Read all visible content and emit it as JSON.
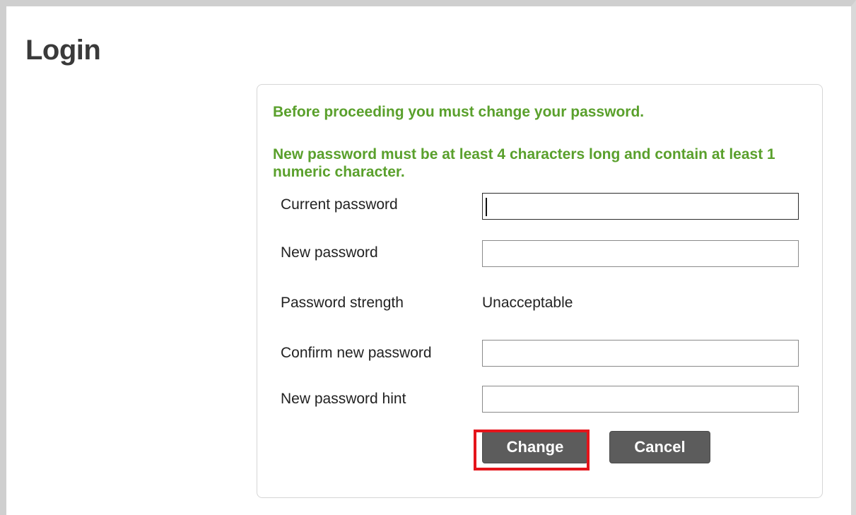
{
  "page": {
    "title": "Login"
  },
  "notices": {
    "line1": "Before proceeding you must change your password.",
    "line2": "New password must be at least 4 characters long and contain at least 1 numeric character."
  },
  "form": {
    "current_password": {
      "label": "Current password",
      "value": ""
    },
    "new_password": {
      "label": "New password",
      "value": ""
    },
    "password_strength": {
      "label": "Password strength",
      "value": "Unacceptable"
    },
    "confirm_new_password": {
      "label": "Confirm new password",
      "value": ""
    },
    "new_password_hint": {
      "label": "New password hint",
      "value": ""
    }
  },
  "buttons": {
    "change_label": "Change",
    "cancel_label": "Cancel"
  },
  "colors": {
    "notice_text": "#5aa02c",
    "button_bg": "#5c5c5c",
    "highlight_border": "#e4141b"
  }
}
